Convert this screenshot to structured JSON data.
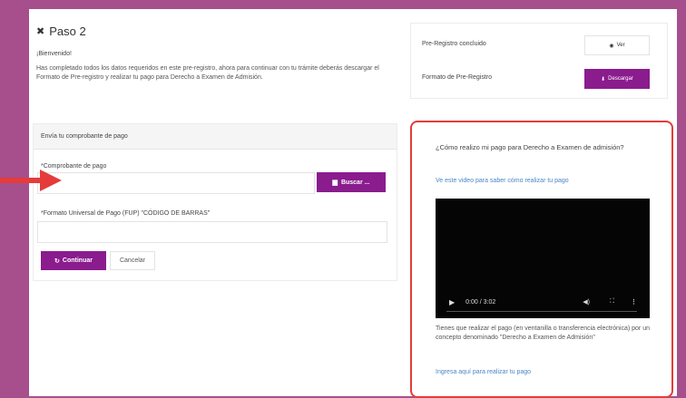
{
  "step_title": "Paso 2",
  "welcome": "¡Bienvenido!",
  "intro": "Has completado todos los datos requeridos en este pre-registro, ahora para continuar con tu trámite deberás descargar el Formato de Pre-registro y realizar tu pago para Derecho a Examen de Admisión.",
  "form": {
    "heading": "Envía tu comprobante de pago",
    "receipt_label": "*Comprobante de pago",
    "browse_label": "Buscar ...",
    "fup_label": "*Formato Universal de Pago (FUP) \"CÓDIGO DE BARRAS\"",
    "continue_label": "Continuar",
    "cancel_label": "Cancelar"
  },
  "status": {
    "pre_registro_label": "Pre-Registro concluido",
    "ver_label": "Ver",
    "formato_label": "Formato de Pre-Registro",
    "descargar_label": "Descargar"
  },
  "video_panel": {
    "heading": "¿Cómo realizo mi pago para Derecho a Examen de admisión?",
    "subtext": "Ve este video para saber cómo realizar tu pago",
    "time": "0:00 / 3:02",
    "note": "Tienes que realizar el pago (en ventanilla o transferencia electrónica) por un concepto denominado \"Derecho a Examen de Admisión\"",
    "link": "Ingresa aquí para realizar tu pago"
  },
  "colors": {
    "background": "#a64f8c",
    "primary": "#8a1c8e",
    "highlight_border": "#e53b3b",
    "arrow": "#e53b3b"
  }
}
